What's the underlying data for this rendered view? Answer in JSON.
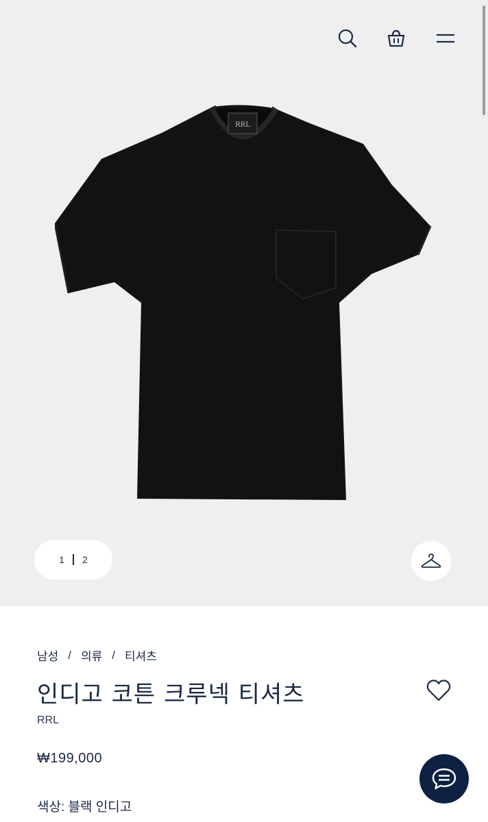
{
  "header": {
    "icons": [
      "search-icon",
      "shopping-bag-icon",
      "menu-icon"
    ]
  },
  "gallery": {
    "pager": {
      "current": "1",
      "total": "2"
    },
    "image_alt": "black pocket crewneck t-shirt"
  },
  "breadcrumb": [
    "남성",
    "의류",
    "티셔츠"
  ],
  "product": {
    "title": "인디고 코튼 크루넥 티셔츠",
    "brand": "RRL",
    "price": "₩199,000",
    "color_label": "색상:",
    "color_value": "블랙 인디고"
  },
  "colors": {
    "hero_bg": "#efefef",
    "text": "#1a2a44",
    "chat_bg": "#0e2143"
  }
}
